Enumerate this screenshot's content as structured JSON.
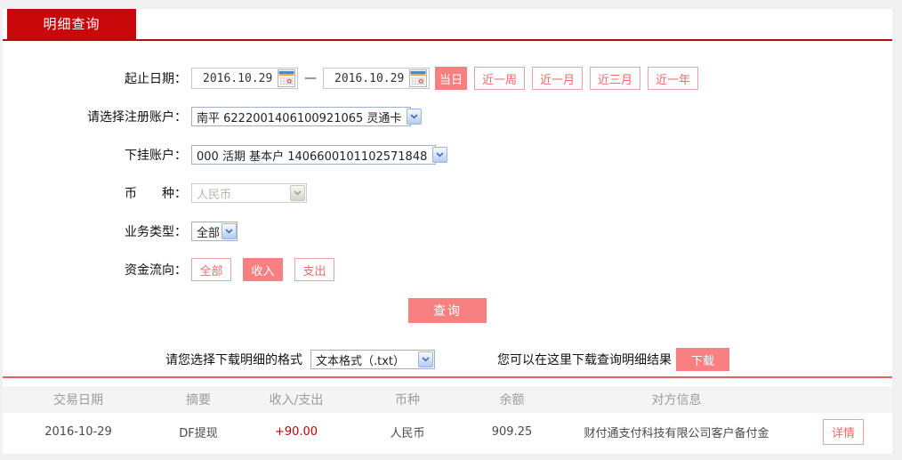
{
  "tab": {
    "label": "明细查询"
  },
  "form": {
    "date_range": {
      "label": "起止日期：",
      "start": "2016.10.29",
      "end": "2016.10.29",
      "separator": "—",
      "quick_buttons": [
        {
          "label": "当日",
          "active": true
        },
        {
          "label": "近一周",
          "active": false
        },
        {
          "label": "近一月",
          "active": false
        },
        {
          "label": "近三月",
          "active": false
        },
        {
          "label": "近一年",
          "active": false
        }
      ]
    },
    "register_account": {
      "label": "请选择注册账户：",
      "value": "南平 6222001406100921065 灵通卡"
    },
    "sub_account": {
      "label": "下挂账户：",
      "value": "000 活期 基本户 1406600101102571848"
    },
    "currency": {
      "label": "币　　种：",
      "value": "人民币",
      "disabled": true
    },
    "business_type": {
      "label": "业务类型：",
      "value": "全部"
    },
    "fund_flow": {
      "label": "资金流向：",
      "options": [
        {
          "label": "全部",
          "active": false
        },
        {
          "label": "收入",
          "active": true
        },
        {
          "label": "支出",
          "active": false
        }
      ]
    },
    "query_button": "查询"
  },
  "download": {
    "format_label": "请您选择下载明细的格式",
    "format_value": "文本格式（.txt）",
    "hint": "您可以在这里下载查询明细结果",
    "button": "下载"
  },
  "table": {
    "headers": [
      "交易日期",
      "摘要",
      "收入/支出",
      "币种",
      "余额",
      "对方信息"
    ],
    "rows": [
      {
        "date": "2016-10-29",
        "summary": "DF提现",
        "amount": "+90.00",
        "currency": "人民币",
        "balance": "909.25",
        "counterparty": "财付通支付科技有限公司客户备付金",
        "action": "详情"
      }
    ]
  },
  "colors": {
    "tab_red": "#c9080c",
    "underline_red": "#b30d10",
    "button_fill": "#f88080",
    "button_border": "#f2a2a2",
    "divider_red": "#e25f5f",
    "amount_red": "#c40000"
  }
}
